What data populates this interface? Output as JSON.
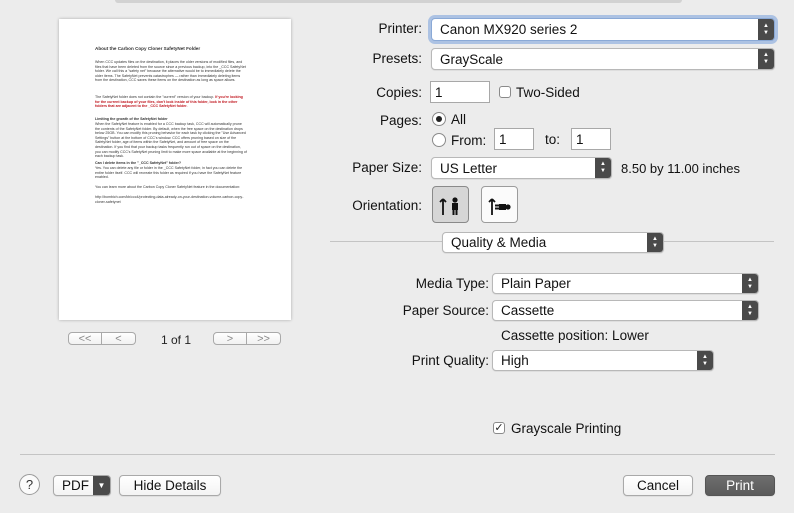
{
  "preview": {
    "title": "About the Carbon Copy Cloner SafetyNet Folder",
    "paragraphs": [
      {
        "text": "When CCC updates files on the destination, it places the older versions of modified files, and files that have been deleted from the source since a previous backup, into the _CCC SafetyNet folder. We call this a \"safety net\" because the alternative would be to immediately delete the older items. The SafetyNet prevents catastrophes — rather than immediately deleting items from the destination, CCC saves these items on the destination as long as space allows.",
        "style": "normal"
      },
      {
        "text": "The SafetyNet folder does not contain the \"current\" version of your backup. If you're looking for the current backup of your files, don't look inside of this folder, look in the other folders that are adjacent to the _CCC SafetyNet folder.",
        "style": "mixed"
      },
      {
        "text": "Limiting the growth of the SafetyNet folder",
        "style": "heading"
      },
      {
        "text": "When the SafetyNet feature is enabled for a CCC backup task, CCC will automatically prune the contents of the SafetyNet folder. By default, when the free space on the destination drops below 25GB. You can modify this pruning behavior for each task by clicking the \"Use Advanced Settings\" button at the bottom of CCC's window. CCC offers pruning based on size of the SafetyNet folder, age of items within the SafetyNet, and amount of free space on the destination. If you find that your backup tasks frequently run out of space on the destination, you can modify CCC's SafetyNet pruning limit to make more space available at the beginning of each backup task.",
        "style": "normal"
      },
      {
        "text": "Can I delete items in the \"_CCC SafetyNet\" folder?",
        "style": "heading"
      },
      {
        "text": "Yes. You can delete any file or folder in the _CCC SafetyNet folder, in fact you can delete the entire folder itself. CCC will recreate this folder as required if you have the SafetyNet feature enabled.",
        "style": "normal"
      },
      {
        "text": "You can learn more about the Carbon Copy Cloner SafetyNet feature in the documentation:",
        "style": "normal"
      },
      {
        "text": "http://bombich.com/kb/ccc4/protecting-data-already-on-your-destination-volume-carbon-copy-cloner-safetynet",
        "style": "normal"
      }
    ],
    "red_text": "If you're looking for the current backup of your files, don't look inside of this folder, look in the other folders that are adjacent to the _CCC SafetyNet folder.",
    "page_indicator": "1 of 1",
    "nav": {
      "first": "<<",
      "prev": "<",
      "next": ">",
      "last": ">>"
    }
  },
  "printer": {
    "label": "Printer:",
    "value": "Canon MX920 series 2"
  },
  "presets": {
    "label": "Presets:",
    "value": "GrayScale"
  },
  "copies": {
    "label": "Copies:",
    "value": "1",
    "two_sided_label": "Two-Sided",
    "two_sided_checked": false
  },
  "pages": {
    "label": "Pages:",
    "all_label": "All",
    "from_label": "From:",
    "from_value": "1",
    "to_label": "to:",
    "to_value": "1",
    "selected": "all"
  },
  "paper_size": {
    "label": "Paper Size:",
    "value": "US Letter",
    "dimensions": "8.50 by 11.00 inches"
  },
  "orientation": {
    "label": "Orientation:",
    "selected": "portrait",
    "icons": [
      "portrait-orientation-icon",
      "landscape-orientation-icon"
    ]
  },
  "section": {
    "value": "Quality & Media"
  },
  "media_type": {
    "label": "Media Type:",
    "value": "Plain Paper"
  },
  "paper_source": {
    "label": "Paper Source:",
    "value": "Cassette",
    "note": "Cassette position: Lower"
  },
  "print_quality": {
    "label": "Print Quality:",
    "value": "High"
  },
  "grayscale": {
    "label": "Grayscale Printing",
    "checked": true
  },
  "footer": {
    "help": "?",
    "pdf": "PDF",
    "hide_details": "Hide Details",
    "cancel": "Cancel",
    "print": "Print"
  },
  "colors": {
    "focus_ring": "#78a0dc",
    "primary_button": "#5f5f5f",
    "dialog_bg": "#ececec",
    "warning_text": "#c0141c"
  }
}
